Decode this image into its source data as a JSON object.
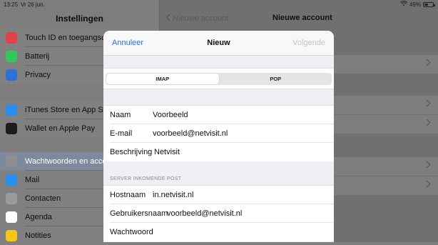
{
  "status": {
    "time": "13:25",
    "date": "Vr 26 jun.",
    "battery": "49%",
    "battery_level": 0.49
  },
  "sidebar": {
    "title": "Instellingen",
    "groups": [
      [
        {
          "label": "Touch ID en toegangscode",
          "icon": "fingerprint-icon",
          "color": "#e2404a"
        },
        {
          "label": "Batterij",
          "icon": "battery-icon",
          "color": "#34c759"
        },
        {
          "label": "Privacy",
          "icon": "hand-icon",
          "color": "#2f6fd8"
        }
      ],
      [
        {
          "label": "iTunes Store en App Store",
          "icon": "app-store-icon",
          "color": "#2a8ef0"
        },
        {
          "label": "Wallet en Apple Pay",
          "icon": "wallet-icon",
          "color": "#1c1c1e"
        }
      ],
      [
        {
          "label": "Wachtwoorden en accounts",
          "icon": "key-icon",
          "color": "#8e8e93",
          "selected": true
        },
        {
          "label": "Mail",
          "icon": "mail-icon",
          "color": "#2a8ef0"
        },
        {
          "label": "Contacten",
          "icon": "contacts-icon",
          "color": "#9a9a9e"
        },
        {
          "label": "Agenda",
          "icon": "calendar-icon",
          "color": "#ffffff"
        },
        {
          "label": "Notities",
          "icon": "notes-icon",
          "color": "#f5c518"
        }
      ]
    ]
  },
  "detail": {
    "back_label": "Nieuwe account",
    "title": "Nieuwe account"
  },
  "modal": {
    "cancel": "Annuleer",
    "title": "Nieuw",
    "next": "Volgende",
    "segments": [
      {
        "label": "IMAP",
        "active": true
      },
      {
        "label": "POP",
        "active": false
      }
    ],
    "fields": [
      {
        "key": "Naam",
        "value": "Voorbeeld"
      },
      {
        "key": "E-mail",
        "value": "voorbeeld@netvisit.nl"
      },
      {
        "key": "Beschrijving",
        "value": "Netvisit"
      }
    ],
    "incoming_header": "SERVER INKOMENDE POST",
    "incoming": [
      {
        "key": "Hostnaam",
        "value": "in.netvisit.nl"
      },
      {
        "key": "Gebruikersnaam",
        "value": "voorbeeld@netvisit.nl"
      },
      {
        "key": "Wachtwoord",
        "value": ""
      }
    ]
  }
}
